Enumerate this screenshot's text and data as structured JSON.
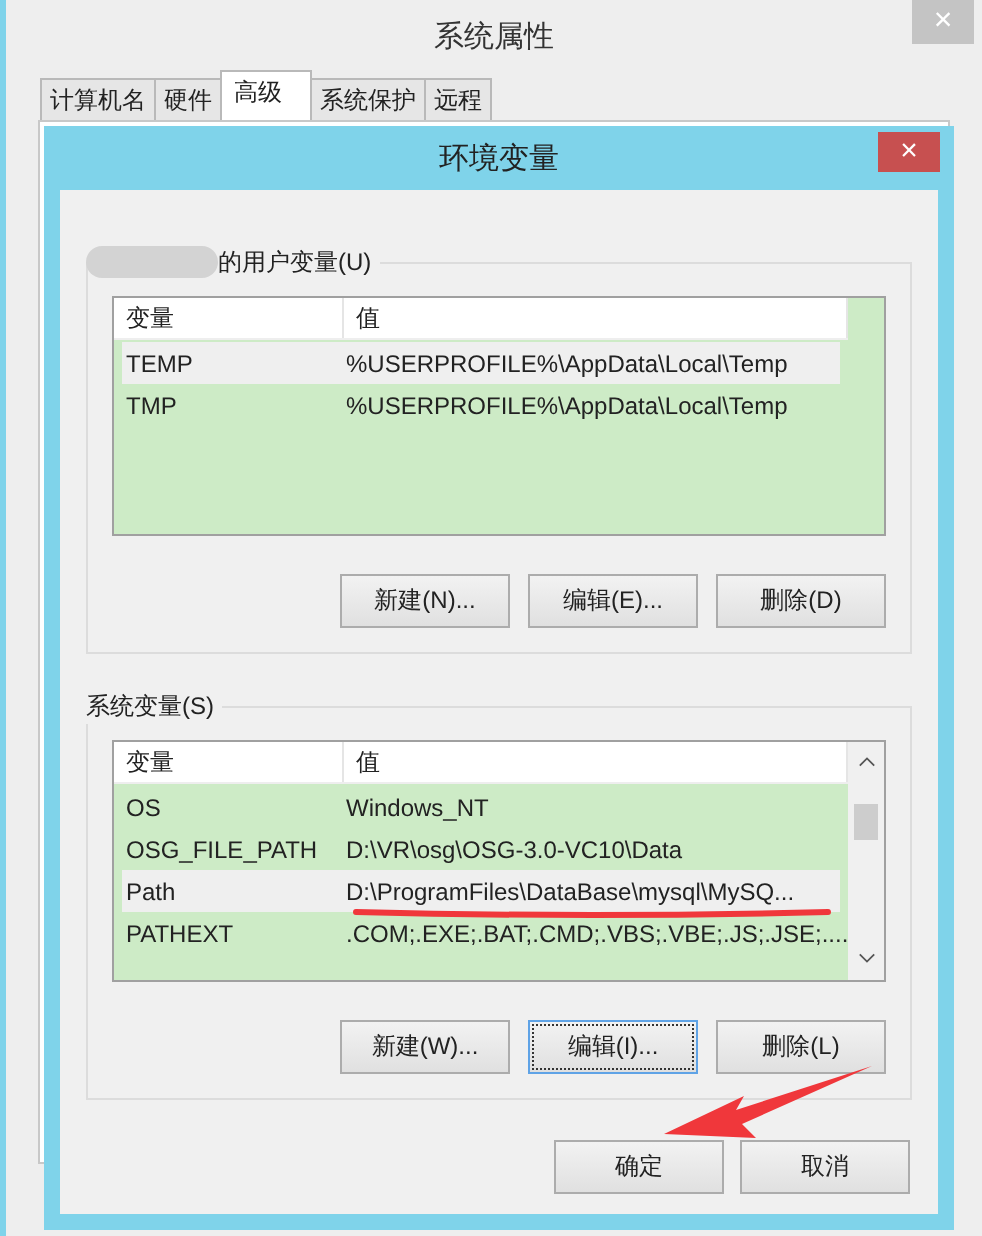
{
  "window": {
    "title": "系统属性",
    "close": "×"
  },
  "tabs": [
    {
      "label": "计算机名",
      "selected": false
    },
    {
      "label": "硬件",
      "selected": false
    },
    {
      "label": "高级",
      "selected": true
    },
    {
      "label": "系统保护",
      "selected": false
    },
    {
      "label": "远程",
      "selected": false
    }
  ],
  "dialog": {
    "title": "环境变量",
    "close": "×"
  },
  "user_vars": {
    "label": "的用户变量(U)",
    "columns": [
      "变量",
      "值"
    ],
    "rows": [
      {
        "name": "TEMP",
        "value": "%USERPROFILE%\\AppData\\Local\\Temp",
        "selected": true
      },
      {
        "name": "TMP",
        "value": "%USERPROFILE%\\AppData\\Local\\Temp",
        "selected": false
      }
    ],
    "buttons": [
      {
        "label": "新建(N)...",
        "focused": false
      },
      {
        "label": "编辑(E)...",
        "focused": false
      },
      {
        "label": "删除(D)",
        "focused": false
      }
    ]
  },
  "system_vars": {
    "label": "系统变量(S)",
    "columns": [
      "变量",
      "值"
    ],
    "rows": [
      {
        "name": "OS",
        "value": "Windows_NT",
        "selected": false
      },
      {
        "name": "OSG_FILE_PATH",
        "value": "D:\\VR\\osg\\OSG-3.0-VC10\\Data",
        "selected": false
      },
      {
        "name": "Path",
        "value": "D:\\ProgramFiles\\DataBase\\mysql\\MySQ...",
        "selected": true
      },
      {
        "name": "PATHEXT",
        "value": ".COM;.EXE;.BAT;.CMD;.VBS;.VBE;.JS;.JSE;....",
        "selected": false
      }
    ],
    "buttons": [
      {
        "label": "新建(W)...",
        "focused": false
      },
      {
        "label": "编辑(I)...",
        "focused": true
      },
      {
        "label": "删除(L)",
        "focused": false
      }
    ]
  },
  "footer_buttons": [
    {
      "label": "确定"
    },
    {
      "label": "取消"
    }
  ]
}
